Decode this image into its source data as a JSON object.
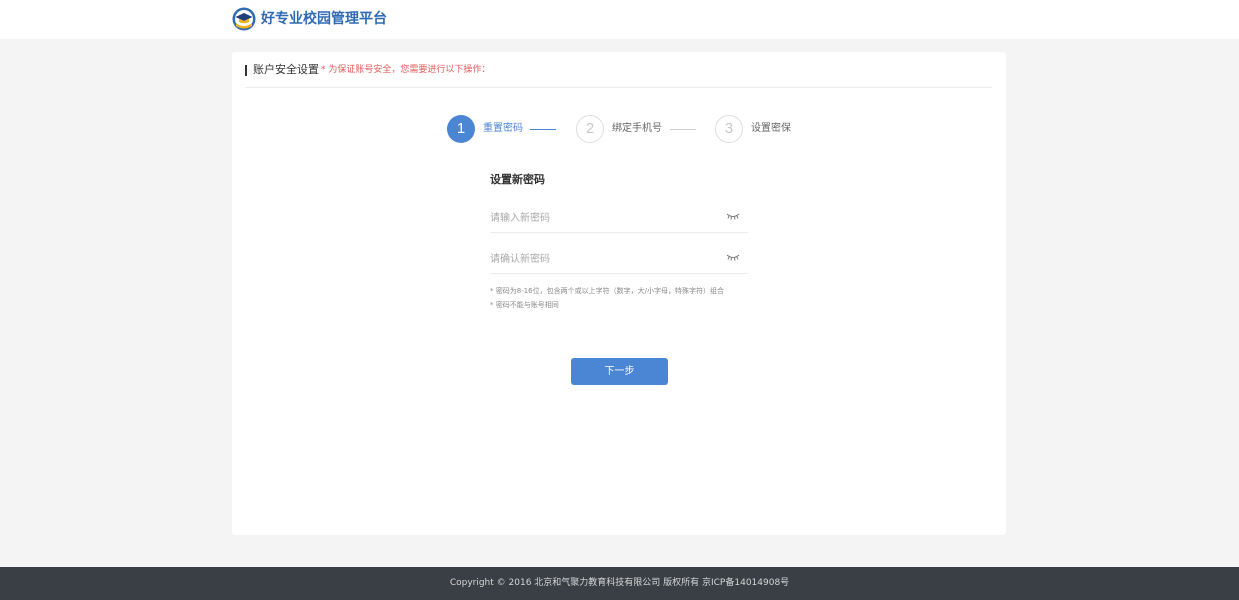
{
  "header": {
    "brand_name": "好专业校园管理平台",
    "logo_icon": "graduation-cap-logo-icon",
    "brand_color": "#2f6bb3"
  },
  "card": {
    "title": "账户安全设置",
    "note": "* 为保证账号安全，您需要进行以下操作："
  },
  "steps": [
    {
      "number": "1",
      "label": "重置密码",
      "state": "active"
    },
    {
      "number": "2",
      "label": "绑定手机号",
      "state": "inactive"
    },
    {
      "number": "3",
      "label": "设置密保",
      "state": "inactive"
    }
  ],
  "form": {
    "title": "设置新密码",
    "new_password": {
      "value": "",
      "placeholder": "请输入新密码",
      "icon": "eye-closed-icon"
    },
    "confirm_password": {
      "value": "",
      "placeholder": "请确认新密码",
      "icon": "eye-closed-icon"
    },
    "hints": [
      "* 密码为8-16位，包含两个或以上字符（数字，大/小字母，特殊字符）组合",
      "* 密码不能与账号相同"
    ],
    "next_button": "下一步"
  },
  "footer": {
    "copyright": "Copyright © 2016 北京和气聚力教育科技有限公司 版权所有 京ICP备14014908号"
  },
  "colors": {
    "accent": "#4a86d4",
    "warning": "#e45b5b",
    "footer_bg": "#3a3f45",
    "page_bg": "#f4f4f4"
  }
}
